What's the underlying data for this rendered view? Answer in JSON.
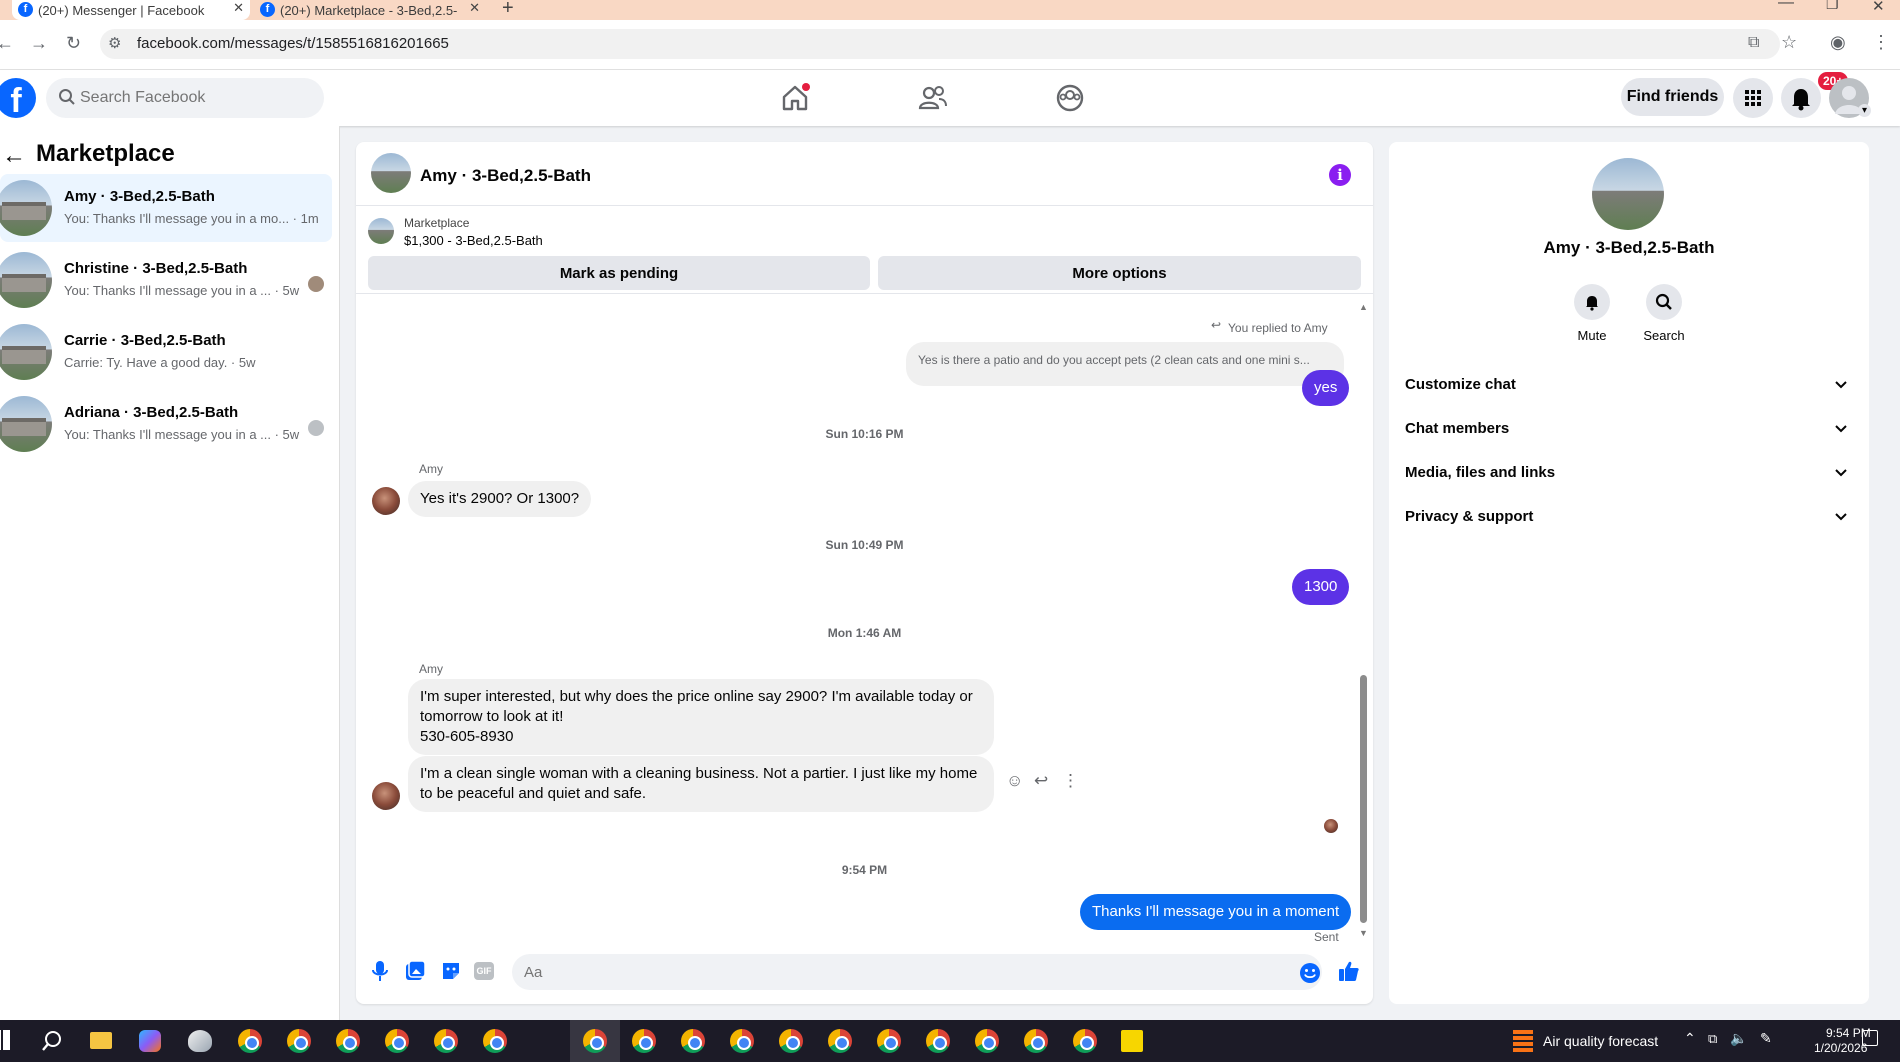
{
  "browser": {
    "tabs": [
      {
        "label": "(20+) Messenger | Facebook",
        "active": true
      },
      {
        "label": "(20+) Marketplace - 3-Bed,2.5-",
        "active": false
      }
    ],
    "url": "facebook.com/messages/t/1585516816201665"
  },
  "header": {
    "search_placeholder": "Search Facebook",
    "find_friends": "Find friends",
    "notif_badge": "20+"
  },
  "left": {
    "title": "Marketplace",
    "conversations": [
      {
        "name": "Amy · 3-Bed,2.5-Bath",
        "snippet": "You: Thanks I'll message you in a mo... · 1m",
        "selected": true
      },
      {
        "name": "Christine · 3-Bed,2.5-Bath",
        "snippet": "You: Thanks I'll message you in a ... · 5w",
        "selected": false
      },
      {
        "name": "Carrie · 3-Bed,2.5-Bath",
        "snippet": "Carrie: Ty. Have a good day. · 5w",
        "selected": false
      },
      {
        "name": "Adriana · 3-Bed,2.5-Bath",
        "snippet": "You: Thanks I'll message you in a ... · 5w",
        "selected": false
      }
    ]
  },
  "chat": {
    "title": "Amy · 3-Bed,2.5-Bath",
    "marketplace_label": "Marketplace",
    "listing": "$1,300 - 3-Bed,2.5-Bath",
    "mark_pending": "Mark as pending",
    "more_options": "More options",
    "replied_note": "You replied to Amy",
    "quoted": "Yes is there a patio and do you accept pets (2 clean cats and one mini s...",
    "msg_yes": "yes",
    "ts1": "Sun 10:16 PM",
    "sender1": "Amy",
    "msg_amy1": "Yes it's 2900? Or 1300?",
    "ts2": "Sun 10:49 PM",
    "msg_1300": "1300",
    "ts3": "Mon 1:46 AM",
    "sender2": "Amy",
    "msg_amy2_line1": "I'm super interested, but why does the price online say 2900? I'm available today or",
    "msg_amy2_line2": "tomorrow to look at it!",
    "msg_amy2_line3": "530-605-8930",
    "msg_amy3_line1": "I'm a clean single woman with a cleaning business. Not a partier. I just like my home",
    "msg_amy3_line2": "to be peaceful and quiet and safe.",
    "ts4": "9:54 PM",
    "msg_last": "Thanks I'll message you in a moment",
    "sent": "Sent",
    "composer_placeholder": "Aa"
  },
  "right": {
    "name": "Amy · 3-Bed,2.5-Bath",
    "mute": "Mute",
    "search": "Search",
    "sections": [
      "Customize chat",
      "Chat members",
      "Media, files and links",
      "Privacy & support"
    ]
  },
  "taskbar": {
    "weather": "Air quality forecast",
    "time": "9:54 PM",
    "date": "1/20/2026"
  },
  "colors": {
    "fb_blue": "#0866ff",
    "outgoing_purple": "#5c32e6",
    "outgoing_blue": "#0a6cf0",
    "badge_red": "#e41e3f"
  }
}
